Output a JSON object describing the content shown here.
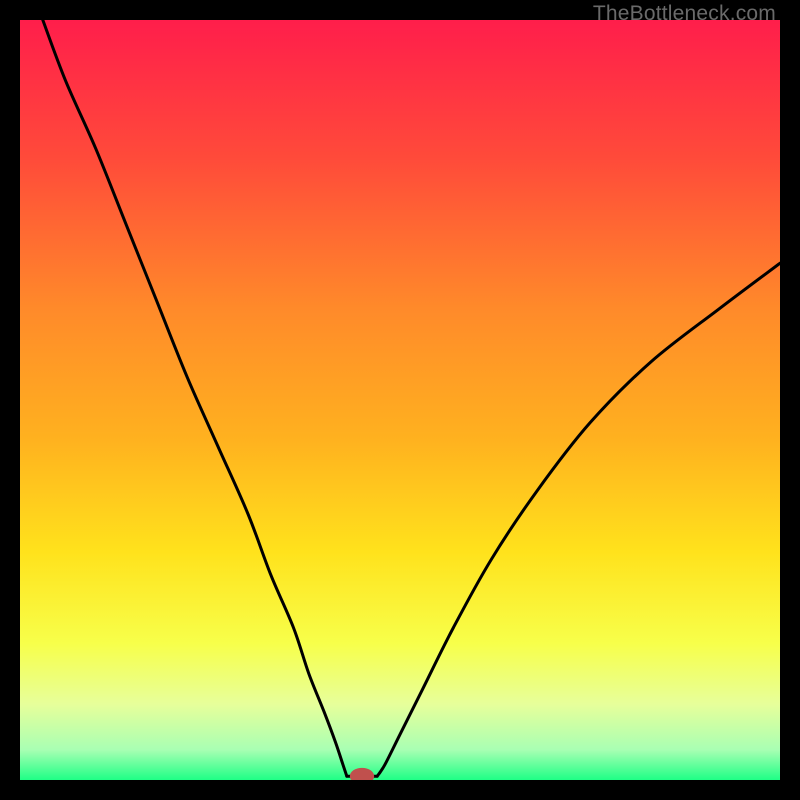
{
  "watermark": "TheBottleneck.com",
  "chart_data": {
    "type": "line",
    "title": "",
    "xlabel": "",
    "ylabel": "",
    "xlim": [
      0,
      100
    ],
    "ylim": [
      0,
      100
    ],
    "background_gradient": [
      {
        "stop": 0.0,
        "color": "#ff1e4b"
      },
      {
        "stop": 0.18,
        "color": "#ff4a3a"
      },
      {
        "stop": 0.38,
        "color": "#ff8a2a"
      },
      {
        "stop": 0.55,
        "color": "#ffbél1f"
      },
      {
        "stop": 0.7,
        "color": "#ffe21c"
      },
      {
        "stop": 0.82,
        "color": "#f7ff4a"
      },
      {
        "stop": 0.9,
        "color": "#e7ff9a"
      },
      {
        "stop": 0.96,
        "color": "#a9ffb3"
      },
      {
        "stop": 1.0,
        "color": "#1fff86"
      }
    ],
    "series": [
      {
        "name": "left-branch",
        "x": [
          3,
          6,
          10,
          14,
          18,
          22,
          26,
          30,
          33,
          36,
          38,
          40,
          41.5,
          42.5,
          43
        ],
        "y": [
          100,
          92,
          83,
          73,
          63,
          53,
          44,
          35,
          27,
          20,
          14,
          9,
          5,
          2,
          0.5
        ]
      },
      {
        "name": "right-branch",
        "x": [
          47,
          48,
          50,
          53,
          57,
          62,
          68,
          75,
          83,
          92,
          100
        ],
        "y": [
          0.5,
          2,
          6,
          12,
          20,
          29,
          38,
          47,
          55,
          62,
          68
        ]
      }
    ],
    "flat_region": {
      "x_start": 43,
      "x_end": 47,
      "y": 0.5
    },
    "marker": {
      "x": 45,
      "y": 0.5,
      "rx": 1.6,
      "ry": 1.1,
      "fill": "#c0504d"
    }
  }
}
